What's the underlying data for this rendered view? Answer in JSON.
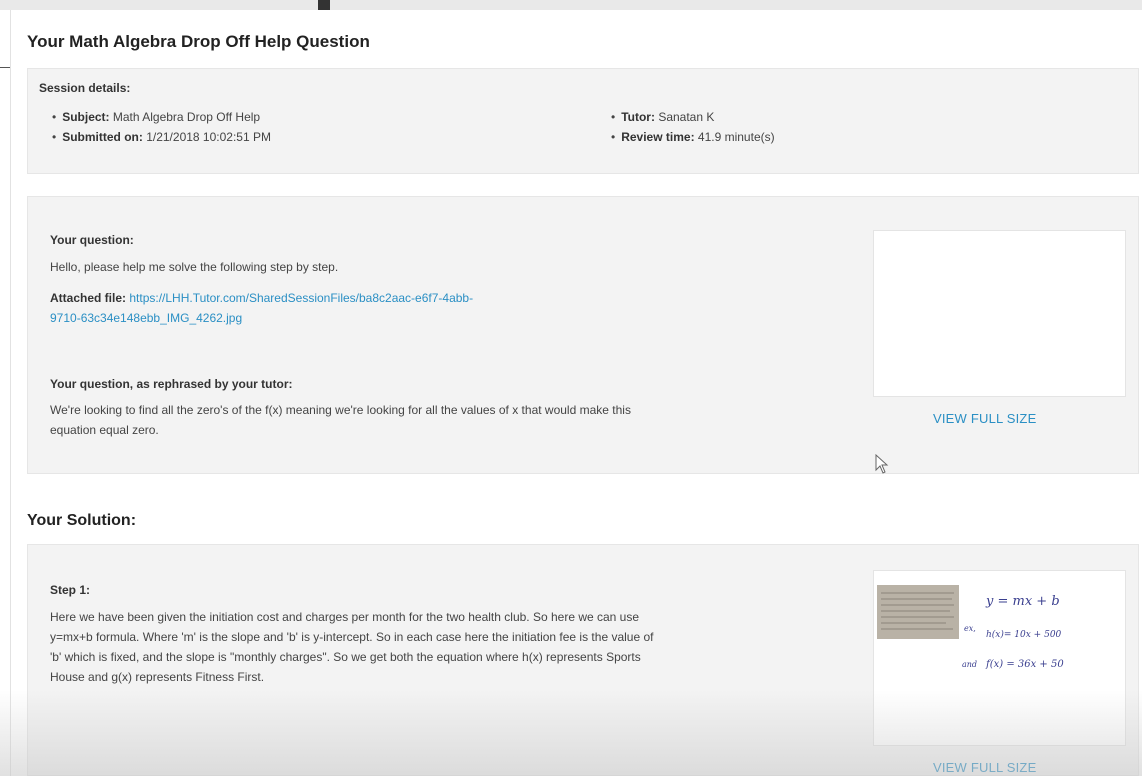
{
  "page": {
    "title": "Your Math Algebra Drop Off Help Question"
  },
  "session": {
    "heading": "Session details:",
    "subject_label": "Subject:",
    "subject_value": "Math Algebra Drop Off Help",
    "submitted_label": "Submitted on:",
    "submitted_value": "1/21/2018 10:02:51 PM",
    "tutor_label": "Tutor:",
    "tutor_value": "Sanatan K",
    "review_label": "Review time:",
    "review_value": "41.9 minute(s)"
  },
  "question": {
    "heading": "Your question:",
    "text": "Hello, please help me solve the following step by step.",
    "attached_label": "Attached file:",
    "attached_line1": "https://LHH.Tutor.com/SharedSessionFiles/ba8c2aac-e6f7-4abb-",
    "attached_line2": "9710-63c34e148ebb_IMG_4262.jpg",
    "rephrased_heading": "Your question, as rephrased by your tutor:",
    "rephrased_line1": "We're looking to find all the zero's of the f(x) meaning we're looking for all the values of x that would make this",
    "rephrased_line2": "equation equal zero.",
    "view_full_label": "VIEW FULL SIZE"
  },
  "solution": {
    "heading": "Your Solution:",
    "step_heading": "Step 1:",
    "step_line1": "Here we have been given the initiation cost and charges per month for the two health club. So here we can use",
    "step_line2": "y=mx+b formula. Where 'm' is the slope and 'b' is y-intercept. So in each case here the initiation fee is the value of",
    "step_line3": "'b' which is fixed, and the slope is \"monthly charges\". So we get both the equation where h(x) represents Sports",
    "step_line4": "House and g(x) represents Fitness First.",
    "view_full_label": "VIEW FULL SIZE",
    "thumb_eq1": "y = mx + b",
    "thumb_eq2": "h(x)= 10x + 500",
    "thumb_eq3": "f(x) = 36x + 50",
    "thumb_left1": "ex,",
    "thumb_left2": "and"
  },
  "icons": {
    "cursor": "mouse-pointer-icon"
  }
}
